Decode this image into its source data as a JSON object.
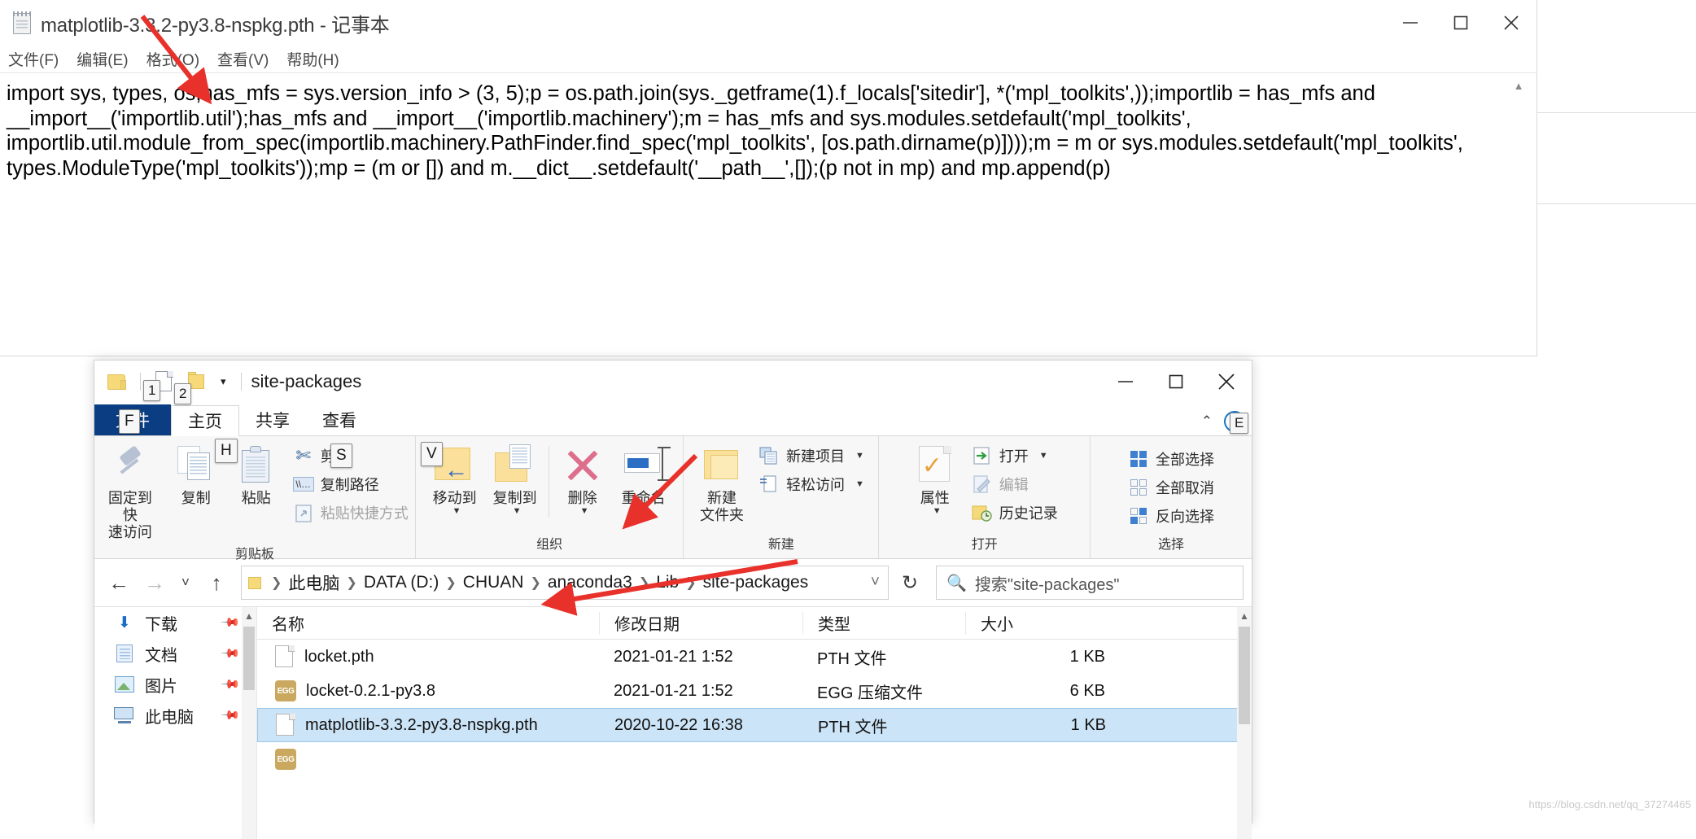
{
  "notepad": {
    "title": "matplotlib-3.3.2-py3.8-nspkg.pth - 记事本",
    "icon": "notepad-icon",
    "menus": [
      "文件(F)",
      "编辑(E)",
      "格式(O)",
      "查看(V)",
      "帮助(H)"
    ],
    "window_buttons": [
      "minimize",
      "maximize",
      "close"
    ],
    "content": "import sys, types, os;has_mfs = sys.version_info > (3, 5);p = os.path.join(sys._getframe(1).f_locals['sitedir'], *('mpl_toolkits',));importlib = has_mfs and __import__('importlib.util');has_mfs and __import__('importlib.machinery');m = has_mfs and sys.modules.setdefault('mpl_toolkits', importlib.util.module_from_spec(importlib.machinery.PathFinder.find_spec('mpl_toolkits', [os.path.dirname(p)])));m = m or sys.modules.setdefault('mpl_toolkits', types.ModuleType('mpl_toolkits'));mp = (m or []) and m.__dict__.setdefault('__path__',[]);(p not in mp) and mp.append(p)"
  },
  "explorer": {
    "title": "site-packages",
    "quick_access": {
      "folder_icon": "folder-icon",
      "new_doc_icon": "new-document-icon",
      "new_folder_icon": "new-folder-icon",
      "customize_caret": "▾",
      "keytips": [
        "1",
        "2"
      ]
    },
    "window_buttons": [
      "minimize",
      "maximize",
      "close"
    ],
    "tabs": [
      {
        "label": "文件",
        "keytip": "F",
        "active": false,
        "style": "file"
      },
      {
        "label": "主页",
        "keytip": "H",
        "active": true
      },
      {
        "label": "共享",
        "keytip": "S",
        "active": false
      },
      {
        "label": "查看",
        "keytip": "V",
        "active": false
      }
    ],
    "ribbon_right": {
      "collapse": "⌃",
      "help": "?",
      "help_keytip": "E"
    },
    "ribbon_groups": [
      {
        "title": "剪贴板",
        "big_buttons": [
          {
            "label": "固定到快\n速访问",
            "icon": "pin-icon"
          },
          {
            "label": "复制",
            "icon": "copy-icon"
          },
          {
            "label": "粘贴",
            "icon": "paste-icon"
          }
        ],
        "small_buttons": [
          {
            "label": "剪切",
            "icon": "scissors-icon",
            "disabled": false
          },
          {
            "label": "复制路径",
            "icon": "copy-path-icon",
            "disabled": false
          },
          {
            "label": "粘贴快捷方式",
            "icon": "paste-shortcut-icon",
            "disabled": true
          }
        ]
      },
      {
        "title": "组织",
        "big_buttons": [
          {
            "label": "移动到",
            "icon": "move-to-icon",
            "caret": "▼"
          },
          {
            "label": "复制到",
            "icon": "copy-to-icon",
            "caret": "▼"
          },
          {
            "label": "删除",
            "icon": "delete-icon",
            "caret": "▼"
          },
          {
            "label": "重命名",
            "icon": "rename-icon"
          }
        ]
      },
      {
        "title": "新建",
        "big_buttons": [
          {
            "label": "新建\n文件夹",
            "icon": "new-folder-icon"
          }
        ],
        "small_buttons": [
          {
            "label": "新建项目",
            "icon": "new-item-icon",
            "caret": "▼"
          },
          {
            "label": "轻松访问",
            "icon": "easy-access-icon",
            "caret": "▼"
          }
        ]
      },
      {
        "title": "打开",
        "big_buttons": [
          {
            "label": "属性",
            "icon": "properties-icon",
            "caret": "▼"
          }
        ],
        "small_buttons": [
          {
            "label": "打开",
            "icon": "open-icon",
            "caret": "▼"
          },
          {
            "label": "编辑",
            "icon": "edit-icon",
            "disabled": true
          },
          {
            "label": "历史记录",
            "icon": "history-icon"
          }
        ]
      },
      {
        "title": "选择",
        "small_buttons": [
          {
            "label": "全部选择",
            "icon": "select-all-icon"
          },
          {
            "label": "全部取消",
            "icon": "select-none-icon"
          },
          {
            "label": "反向选择",
            "icon": "invert-selection-icon"
          }
        ]
      }
    ],
    "address_bar": {
      "back": "←",
      "forward": "→",
      "recent": "˅",
      "up": "↑",
      "breadcrumb": [
        "此电脑",
        "DATA (D:)",
        "CHUAN",
        "anaconda3",
        "Lib",
        "site-packages"
      ],
      "breadcrumb_caret": "˅",
      "refresh": "↻"
    },
    "search": {
      "icon": "search-icon",
      "placeholder": "搜索\"site-packages\""
    },
    "nav_pane": [
      {
        "label": "下载",
        "icon": "downloads-icon",
        "pinned": true
      },
      {
        "label": "文档",
        "icon": "documents-icon",
        "pinned": true
      },
      {
        "label": "图片",
        "icon": "pictures-icon",
        "pinned": true
      },
      {
        "label": "此电脑",
        "icon": "this-pc-icon",
        "pinned": true
      }
    ],
    "columns": [
      "名称",
      "修改日期",
      "类型",
      "大小"
    ],
    "sort_indicator": "⌃",
    "files": [
      {
        "name": "locket.pth",
        "date": "2021-01-21 1:52",
        "type": "PTH 文件",
        "size": "1 KB",
        "icon": "pth-file-icon",
        "selected": false
      },
      {
        "name": "locket-0.2.1-py3.8",
        "date": "2021-01-21 1:52",
        "type": "EGG 压缩文件",
        "size": "6 KB",
        "icon": "egg-file-icon",
        "selected": false
      },
      {
        "name": "matplotlib-3.3.2-py3.8-nspkg.pth",
        "date": "2020-10-22 16:38",
        "type": "PTH 文件",
        "size": "1 KB",
        "icon": "pth-file-icon",
        "selected": true
      }
    ]
  },
  "watermark": "https://blog.csdn.net/qq_37274465",
  "colors": {
    "file_tab_blue": "#0b3d82",
    "selection_blue": "#cce4f7",
    "annotation_red": "#e8312a",
    "folder_yellow": "#f6d978"
  }
}
